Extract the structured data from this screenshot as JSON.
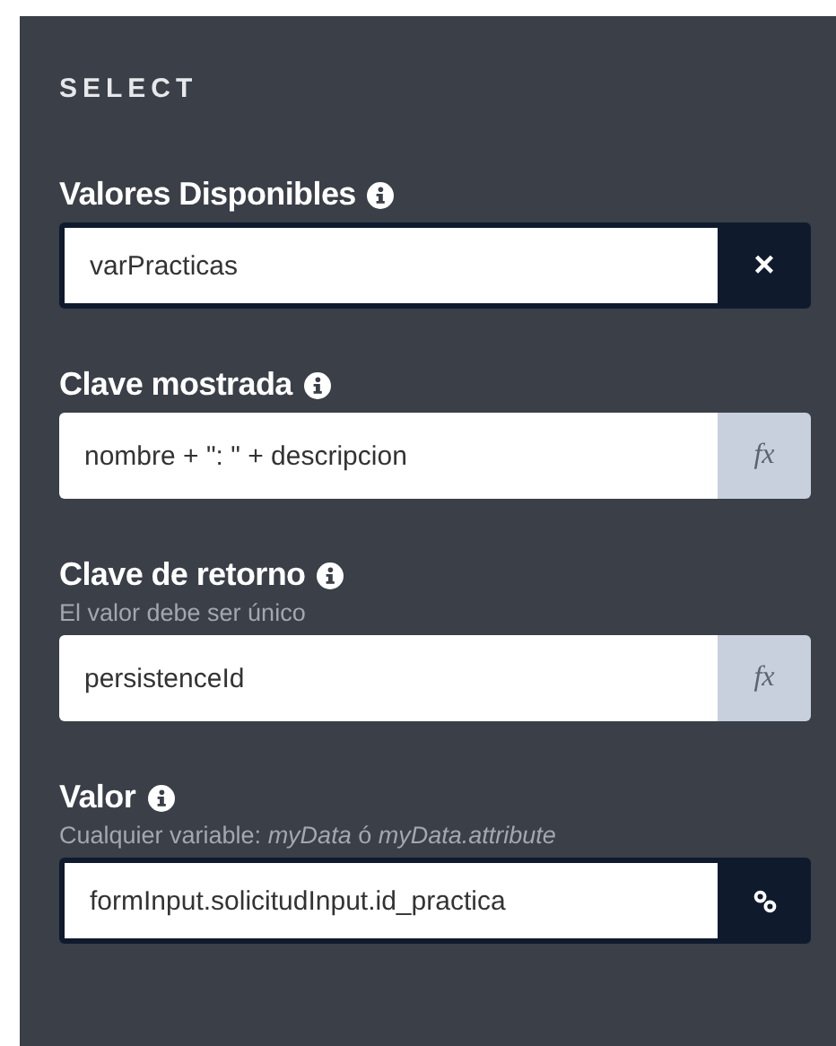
{
  "panel": {
    "title": "SELECT"
  },
  "fields": [
    {
      "label": "Valores Disponibles",
      "value": "varPracticas",
      "addon": {
        "kind": "clear",
        "text": "×"
      }
    },
    {
      "label": "Clave mostrada",
      "value": "nombre + \": \" + descripcion",
      "addon": {
        "kind": "formula",
        "text": "fx"
      }
    },
    {
      "label": "Clave de retorno",
      "hint": "El valor debe ser único",
      "value": "persistenceId",
      "addon": {
        "kind": "formula",
        "text": "fx"
      }
    },
    {
      "label": "Valor",
      "hint": "Cualquier variable: *myData* ó *myData.attribute*",
      "value": "formInput.solicitudInput.id_practica",
      "addon": {
        "kind": "link"
      }
    }
  ]
}
